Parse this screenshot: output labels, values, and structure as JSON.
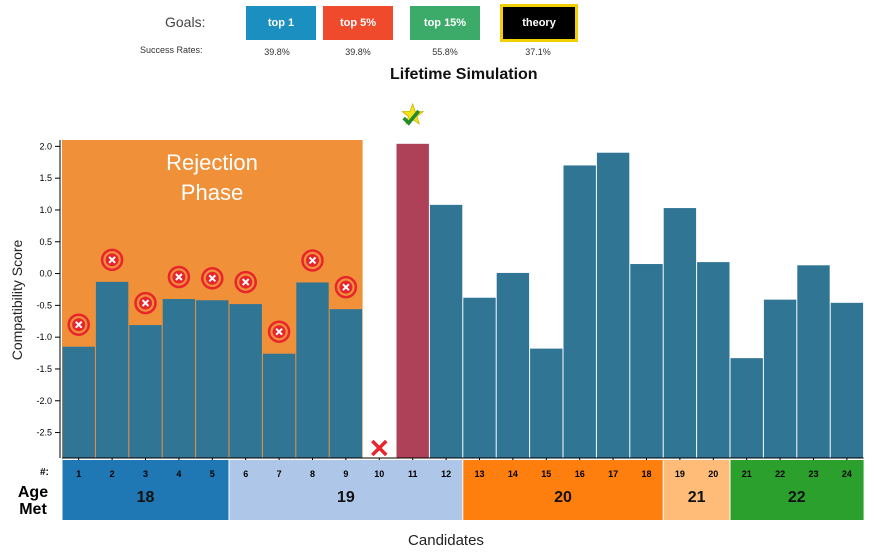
{
  "goals": {
    "label": "Goals:",
    "rates_label": "Success Rates:",
    "buttons": [
      {
        "label": "top 1",
        "rate": "39.8%",
        "color": "#1a8fc0",
        "selected": false
      },
      {
        "label": "top 5%",
        "rate": "39.8%",
        "color": "#ef4a2c",
        "selected": false
      },
      {
        "label": "top 15%",
        "rate": "55.8%",
        "color": "#3cab6a",
        "selected": false
      },
      {
        "label": "theory",
        "rate": "37.1%",
        "color": "#000000",
        "selected": true
      }
    ]
  },
  "chart_data": {
    "type": "bar",
    "title": "Lifetime Simulation",
    "ylabel": "Compatibility Score",
    "xlabel": "Candidates",
    "ylim": [
      -2.9,
      2.1
    ],
    "yticks": [
      "2.0",
      "1.5",
      "1.0",
      "0.5",
      "0.0",
      "-0.5",
      "-1.0",
      "-1.5",
      "-2.0",
      "-2.5"
    ],
    "candidate_row_label": "#:",
    "age_row_label": "Age\nMet",
    "rejection_label": "Rejection\nPhase",
    "rejection_count": 9,
    "categories": [
      "1",
      "2",
      "3",
      "4",
      "5",
      "6",
      "7",
      "8",
      "9",
      "10",
      "11",
      "12",
      "13",
      "14",
      "15",
      "16",
      "17",
      "18",
      "19",
      "20",
      "21",
      "22",
      "23",
      "24"
    ],
    "values": [
      -1.15,
      -0.13,
      -0.81,
      -0.4,
      -0.42,
      -0.48,
      -1.26,
      -0.14,
      -0.56,
      null,
      2.04,
      1.08,
      -0.38,
      0.01,
      -1.18,
      1.7,
      1.9,
      0.15,
      1.03,
      0.18,
      -1.33,
      -0.41,
      0.13,
      -0.46
    ],
    "rejected": [
      1,
      2,
      3,
      4,
      5,
      6,
      7,
      8,
      9
    ],
    "skipped": [
      10
    ],
    "chosen": 11,
    "age_groups": [
      {
        "age": "18",
        "from": 1,
        "to": 5,
        "color": "#1f77b4"
      },
      {
        "age": "19",
        "from": 6,
        "to": 12,
        "color": "#aec7e8"
      },
      {
        "age": "20",
        "from": 13,
        "to": 18,
        "color": "#ff7f0e"
      },
      {
        "age": "21",
        "from": 19,
        "to": 20,
        "color": "#ffbb78"
      },
      {
        "age": "22",
        "from": 21,
        "to": 24,
        "color": "#2ca02c"
      }
    ],
    "colors": {
      "bar": "#317595",
      "chosen_bar": "#ae4057",
      "rejection_bg": "#f0913a",
      "reject_marker": "#e8242c"
    }
  }
}
